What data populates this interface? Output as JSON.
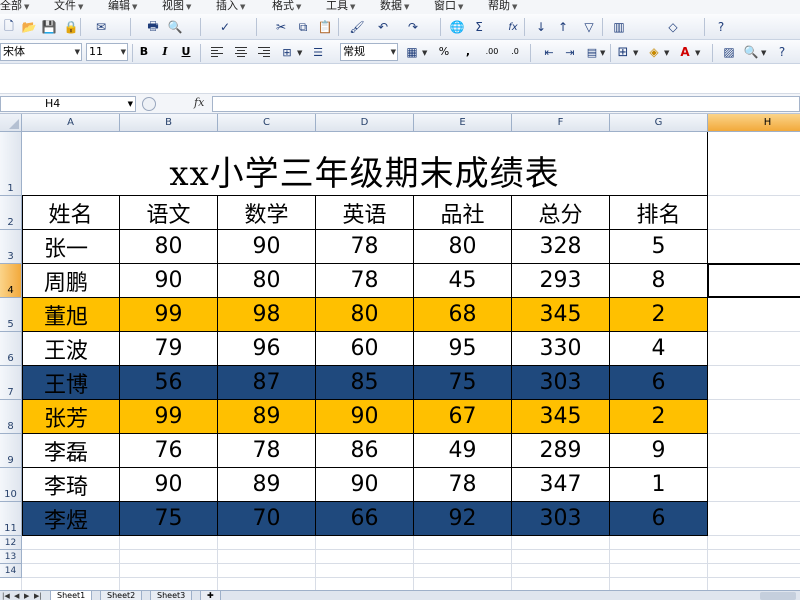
{
  "menu": [
    {
      "label": "全部"
    },
    {
      "label": "文件"
    },
    {
      "label": "编辑"
    },
    {
      "label": "视图"
    },
    {
      "label": "插入"
    },
    {
      "label": "格式"
    },
    {
      "label": "工具"
    },
    {
      "label": "数据"
    },
    {
      "label": "窗口"
    },
    {
      "label": "帮助"
    }
  ],
  "toolbar": {
    "font_name": "宋体",
    "font_size": "11",
    "bold_label": "B",
    "italic_label": "I",
    "underline_label": "U",
    "number_format": "常规",
    "percent_label": "%",
    "comma_label": ",",
    "inc_decimal_label": ".00",
    "dec_decimal_label": ".0",
    "sum_label": "Σ",
    "fx_label": "fx",
    "icons": [
      "new-icon",
      "open-icon",
      "save-icon",
      "permission-icon",
      "mail-icon",
      "print-icon",
      "print-preview-icon",
      "spell-check-icon",
      "cut-icon",
      "copy-icon",
      "paste-icon",
      "format-painter-icon",
      "undo-icon",
      "redo-icon",
      "hyperlink-icon",
      "autosum-icon",
      "function-icon",
      "sort-asc-icon",
      "sort-desc-icon",
      "filter-icon",
      "chart-icon",
      "drawing-icon",
      "help-icon"
    ]
  },
  "formula_bar": {
    "name_box": "H4",
    "fx_symbol": "fx",
    "formula": ""
  },
  "sheet": {
    "columns": [
      "A",
      "B",
      "C",
      "D",
      "E",
      "F",
      "G",
      "H"
    ],
    "rows": [
      "1",
      "2",
      "3",
      "4",
      "5",
      "6",
      "7",
      "8",
      "9",
      "10",
      "11",
      "12",
      "13",
      "14"
    ],
    "active_cell": "H4",
    "title": "xx小学三年级期末成绩表",
    "header": [
      "姓名",
      "语文",
      "数学",
      "英语",
      "品社",
      "总分",
      "排名"
    ],
    "data": [
      {
        "cells": [
          "张一",
          "80",
          "90",
          "78",
          "80",
          "328",
          "5"
        ],
        "fill": ""
      },
      {
        "cells": [
          "周鹏",
          "90",
          "80",
          "78",
          "45",
          "293",
          "8"
        ],
        "fill": ""
      },
      {
        "cells": [
          "董旭",
          "99",
          "98",
          "80",
          "68",
          "345",
          "2"
        ],
        "fill": "#ffc000"
      },
      {
        "cells": [
          "王波",
          "79",
          "96",
          "60",
          "95",
          "330",
          "4"
        ],
        "fill": ""
      },
      {
        "cells": [
          "王博",
          "56",
          "87",
          "85",
          "75",
          "303",
          "6"
        ],
        "fill": "#1f497d"
      },
      {
        "cells": [
          "张芳",
          "99",
          "89",
          "90",
          "67",
          "345",
          "2"
        ],
        "fill": "#ffc000"
      },
      {
        "cells": [
          "李磊",
          "76",
          "78",
          "86",
          "49",
          "289",
          "9"
        ],
        "fill": ""
      },
      {
        "cells": [
          "李琦",
          "90",
          "89",
          "90",
          "78",
          "347",
          "1"
        ],
        "fill": ""
      },
      {
        "cells": [
          "李煜",
          "75",
          "70",
          "66",
          "92",
          "303",
          "6"
        ],
        "fill": "#1f497d"
      }
    ],
    "tabs": [
      "Sheet1",
      "Sheet2",
      "Sheet3"
    ],
    "active_tab": "Sheet1"
  },
  "colors": {
    "highlight_gold": "#ffc000",
    "highlight_navy": "#1f497d",
    "header_active": "#f2a93b",
    "toolbar_blue": "#1f3d7a"
  }
}
